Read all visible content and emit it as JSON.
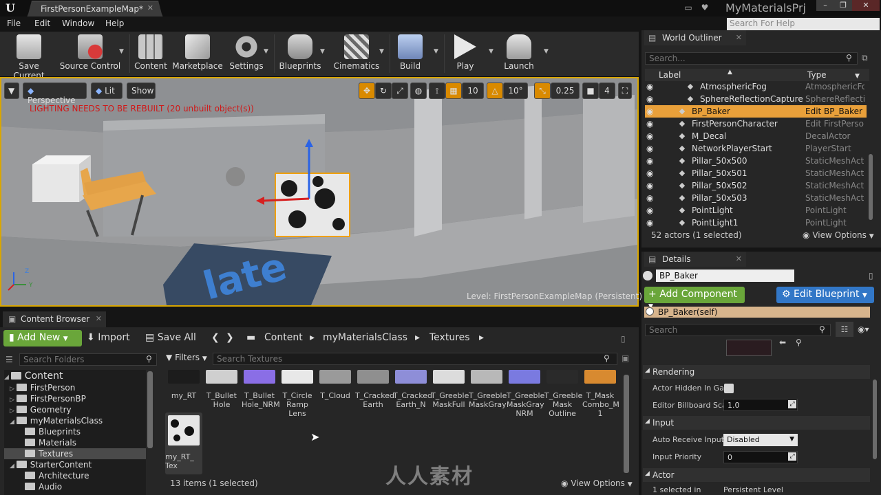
{
  "window": {
    "tab_title": "FirstPersonExampleMap*",
    "project_name": "MyMaterialsPrj",
    "help_search_placeholder": "Search For Help"
  },
  "menu": [
    "File",
    "Edit",
    "Window",
    "Help"
  ],
  "toolbar": [
    {
      "label": "Save Current",
      "icon": "save-icon"
    },
    {
      "label": "Source Control",
      "icon": "source-control-icon"
    },
    {
      "label": "Content",
      "icon": "content-icon"
    },
    {
      "label": "Marketplace",
      "icon": "marketplace-icon"
    },
    {
      "label": "Settings",
      "icon": "gear-icon"
    },
    {
      "label": "Blueprints",
      "icon": "blueprint-icon"
    },
    {
      "label": "Cinematics",
      "icon": "clapper-icon"
    },
    {
      "label": "Build",
      "icon": "build-icon"
    },
    {
      "label": "Play",
      "icon": "play-icon"
    },
    {
      "label": "Launch",
      "icon": "launch-icon"
    }
  ],
  "viewport": {
    "perspective_label": "Perspective",
    "lit_label": "Lit",
    "show_label": "Show",
    "grid_snap": "10",
    "rotation_snap": "10°",
    "scale_snap": "0.25",
    "camera_speed": "4",
    "warning": "LIGHTING NEEDS TO BE REBUILT (20 unbuilt object(s))",
    "level_prefix": "Level:",
    "level_name": "FirstPersonExampleMap (Persistent)"
  },
  "outliner": {
    "title": "World Outliner",
    "search_placeholder": "Search...",
    "col_label": "Label",
    "col_type": "Type",
    "rows": [
      {
        "label": "AtmosphericFog",
        "type": "AtmosphericFog",
        "icon": "fog-icon",
        "indent": 1,
        "selected": false,
        "link": false
      },
      {
        "label": "SphereReflectionCapture",
        "type": "SphereReflectionCapture",
        "icon": "sphere-icon",
        "indent": 1,
        "selected": false,
        "link": false
      },
      {
        "label": "BP_Baker",
        "type": "Edit BP_Baker",
        "icon": "blueprint-actor-icon",
        "indent": 0,
        "selected": true,
        "link": true
      },
      {
        "label": "FirstPersonCharacter",
        "type": "Edit FirstPersonCharacter",
        "icon": "pawn-icon",
        "indent": 0,
        "selected": false,
        "link": true
      },
      {
        "label": "M_Decal",
        "type": "DecalActor",
        "icon": "decal-icon",
        "indent": 0,
        "selected": false,
        "link": false
      },
      {
        "label": "NetworkPlayerStart",
        "type": "PlayerStart",
        "icon": "player-start-icon",
        "indent": 0,
        "selected": false,
        "link": false
      },
      {
        "label": "Pillar_50x500",
        "type": "StaticMeshActor",
        "icon": "static-mesh-icon",
        "indent": 0,
        "selected": false,
        "link": false
      },
      {
        "label": "Pillar_50x501",
        "type": "StaticMeshActor",
        "icon": "static-mesh-icon",
        "indent": 0,
        "selected": false,
        "link": false
      },
      {
        "label": "Pillar_50x502",
        "type": "StaticMeshActor",
        "icon": "static-mesh-icon",
        "indent": 0,
        "selected": false,
        "link": false
      },
      {
        "label": "Pillar_50x503",
        "type": "StaticMeshActor",
        "icon": "static-mesh-icon",
        "indent": 0,
        "selected": false,
        "link": false
      },
      {
        "label": "PointLight",
        "type": "PointLight",
        "icon": "light-icon",
        "indent": 0,
        "selected": false,
        "link": false
      },
      {
        "label": "PointLight1",
        "type": "PointLight",
        "icon": "light-icon",
        "indent": 0,
        "selected": false,
        "link": false
      }
    ],
    "footer": "52 actors (1 selected)",
    "view_options": "View Options"
  },
  "details": {
    "title": "Details",
    "name_value": "BP_Baker",
    "add_component": "Add Component",
    "edit_blueprint": "Edit Blueprint",
    "self_label": "BP_Baker(self)",
    "search_placeholder": "Search",
    "rendering": {
      "header": "Rendering",
      "actor_hidden_label": "Actor Hidden In Gar",
      "billboard_label": "Editor Billboard Sca",
      "billboard_value": "1.0"
    },
    "input": {
      "header": "Input",
      "auto_receive_label": "Auto Receive Input",
      "auto_receive_value": "Disabled",
      "priority_label": "Input Priority",
      "priority_value": "0"
    },
    "actor": {
      "header": "Actor",
      "selected_in_label": "1 selected in",
      "selected_in_value": "Persistent Level"
    }
  },
  "content_browser": {
    "tab_title": "Content Browser",
    "add_new": "Add New",
    "import": "Import",
    "save_all": "Save All",
    "breadcrumb": [
      "Content",
      "myMaterialsClass",
      "Textures"
    ],
    "folder_search_placeholder": "Search Folders",
    "filters_label": "Filters",
    "asset_search_placeholder": "Search Textures",
    "tree": [
      {
        "label": "Content",
        "level": 0,
        "expanded": true
      },
      {
        "label": "FirstPerson",
        "level": 1,
        "expanded": false
      },
      {
        "label": "FirstPersonBP",
        "level": 1,
        "expanded": false
      },
      {
        "label": "Geometry",
        "level": 1,
        "expanded": false
      },
      {
        "label": "myMaterialsClass",
        "level": 1,
        "expanded": true
      },
      {
        "label": "Blueprints",
        "level": 2,
        "expanded": false
      },
      {
        "label": "Materials",
        "level": 2,
        "expanded": false
      },
      {
        "label": "Textures",
        "level": 2,
        "expanded": false,
        "selected": true
      },
      {
        "label": "StarterContent",
        "level": 1,
        "expanded": true
      },
      {
        "label": "Architecture",
        "level": 2,
        "expanded": false
      },
      {
        "label": "Audio",
        "level": 2,
        "expanded": false
      }
    ],
    "assets": [
      {
        "label": "my_RT",
        "color": "#1c1c1c"
      },
      {
        "label": "T_Bullet\nHole",
        "color": "#cfcfcf"
      },
      {
        "label": "T_Bullet\nHole_NRM",
        "color": "#8a6ee6"
      },
      {
        "label": "T_Circle\nRamp\nLens",
        "color": "#e8e8e8"
      },
      {
        "label": "T_Cloud",
        "color": "#9a9a9a"
      },
      {
        "label": "T_Cracked\nEarth",
        "color": "#8f8f8f"
      },
      {
        "label": "T_Cracked\nEarth_N",
        "color": "#8e8ed8"
      },
      {
        "label": "T_Greeble\nMaskFull",
        "color": "#dcdcdc"
      },
      {
        "label": "T_Greeble\nMaskGray",
        "color": "#b8b8b8"
      },
      {
        "label": "T_Greeble\nMaskGray\nNRM",
        "color": "#7a7ae0"
      },
      {
        "label": "T_Greeble\nMask\nOutline",
        "color": "#2a2a2a"
      },
      {
        "label": "T_Mask\nCombo_M\n1",
        "color": "#d88a30"
      }
    ],
    "selected_asset": {
      "label": "my_RT_\nTex"
    },
    "item_count": "13 items (1 selected)",
    "view_options": "View Options"
  },
  "watermark": "人人素材"
}
